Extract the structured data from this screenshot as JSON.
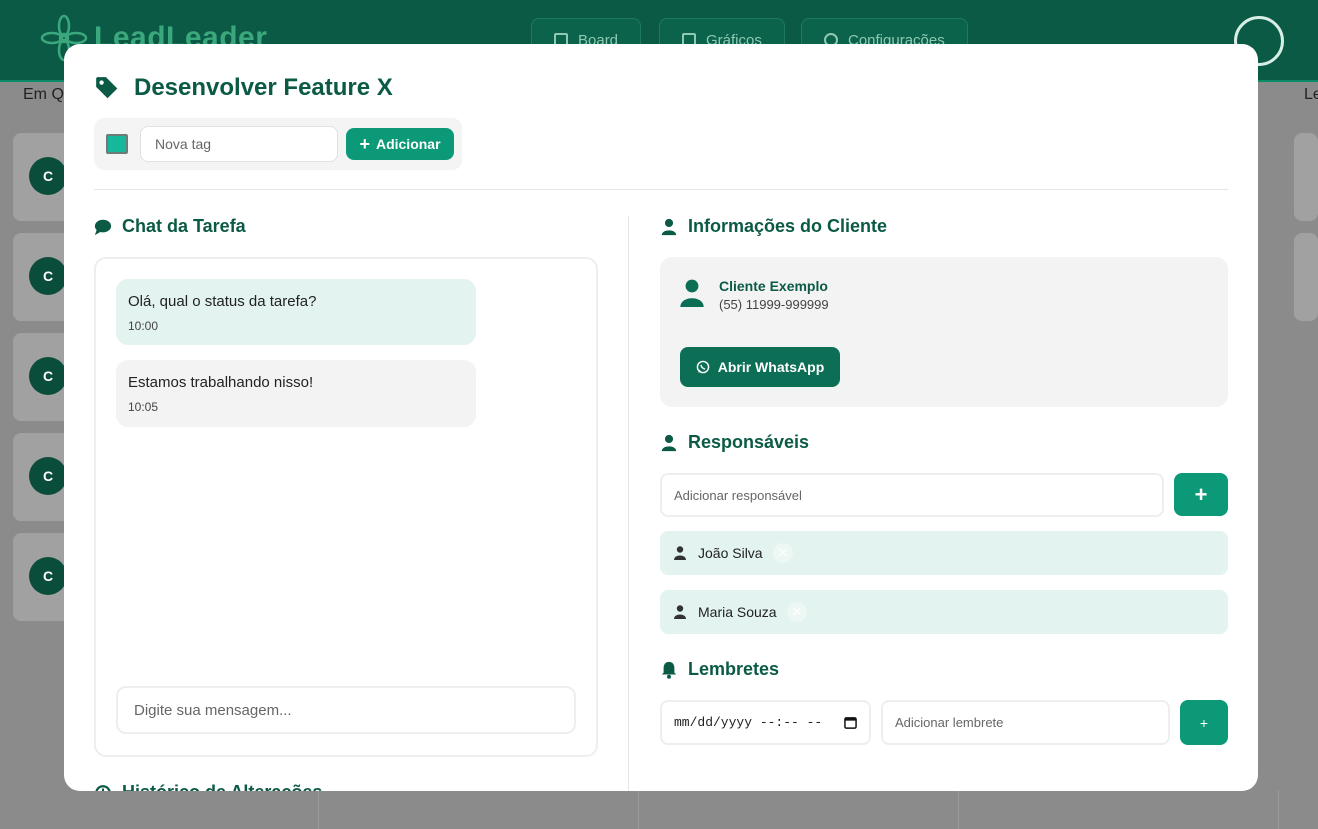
{
  "app": {
    "brand": "LeadLeader",
    "nav": [
      {
        "label": "Board",
        "icon": "board-icon"
      },
      {
        "label": "Gráficos",
        "icon": "grid-icon"
      },
      {
        "label": "Configurações",
        "icon": "gear-icon"
      }
    ],
    "columns": [
      "Em Q",
      "Le"
    ],
    "card_initial": "C"
  },
  "modal": {
    "title": "Desenvolver Feature X",
    "tag": {
      "color": "#15b89a",
      "placeholder": "Nova tag",
      "add_label": "Adicionar"
    },
    "chat": {
      "title": "Chat da Tarefa",
      "messages": [
        {
          "text": "Olá, qual o status da tarefa?",
          "time": "10:00"
        },
        {
          "text": "Estamos trabalhando nisso!",
          "time": "10:05"
        }
      ],
      "input_placeholder": "Digite sua mensagem..."
    },
    "client": {
      "title": "Informações do Cliente",
      "name": "Cliente Exemplo",
      "phone": "(55) 11999-999999",
      "whatsapp_label": "Abrir WhatsApp"
    },
    "responsaveis": {
      "title": "Responsáveis",
      "input_placeholder": "Adicionar responsável",
      "add_label": "+",
      "items": [
        {
          "name": "João Silva"
        },
        {
          "name": "Maria Souza"
        }
      ],
      "remove_label": "✕"
    },
    "lembretes": {
      "title": "Lembretes",
      "date_placeholder": "mm/dd/yyyy --:-- --",
      "input_placeholder": "Adicionar lembrete",
      "add_label": "+"
    },
    "history": {
      "title": "Histórico de Alterações"
    }
  },
  "colors": {
    "primary": "#0b9977",
    "dark": "#0b5a45",
    "light_bg": "#e3f3ef"
  }
}
